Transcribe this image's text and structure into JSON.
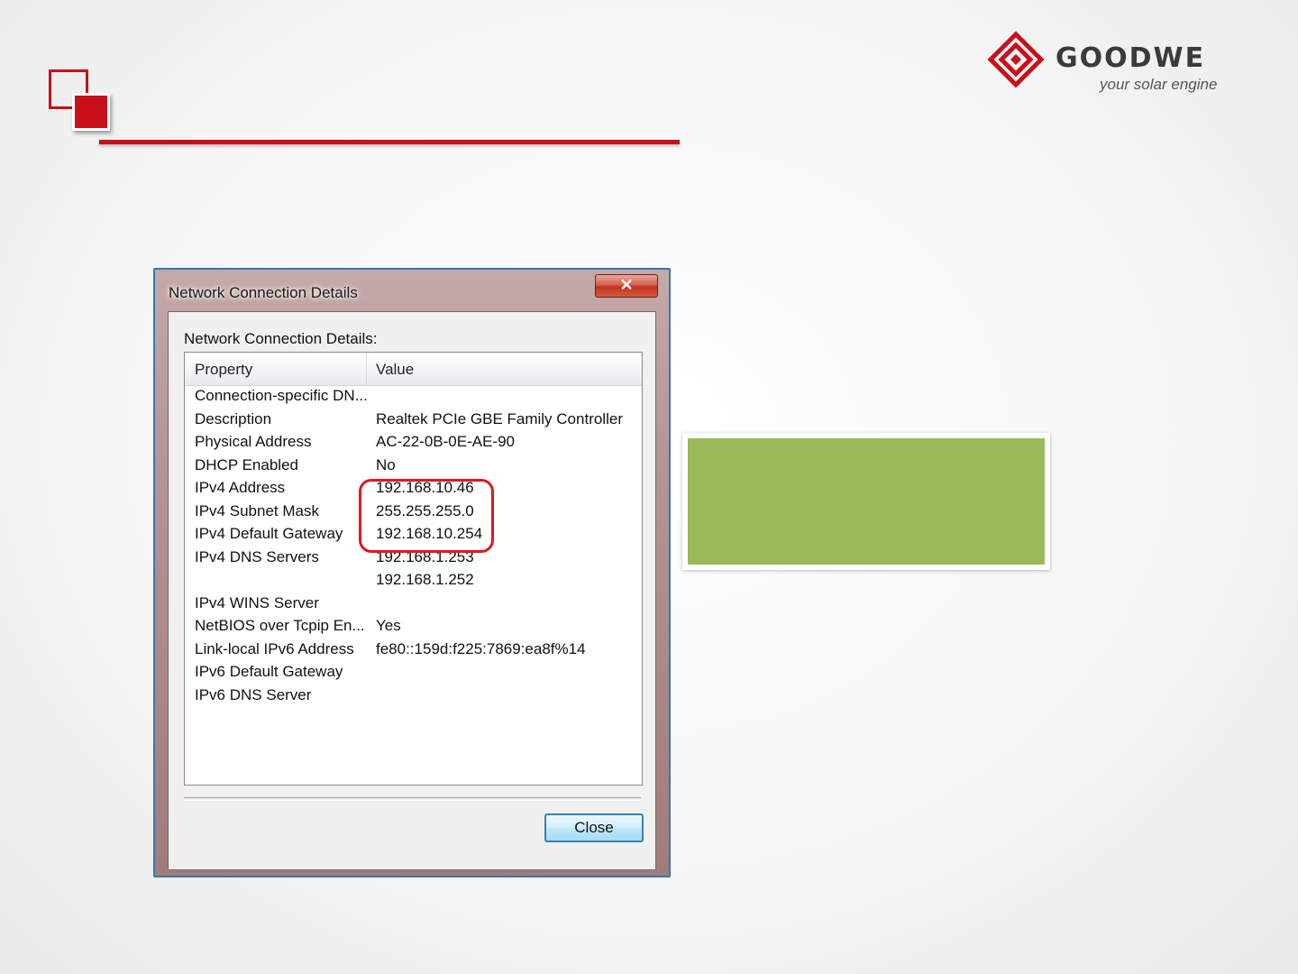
{
  "slide": {
    "accent_color": "#c8101c",
    "logo": {
      "brand": "GOODWE",
      "tagline": "your solar engine",
      "icon": "goodwe-diamond-icon"
    }
  },
  "dialog": {
    "title": "Network Connection Details",
    "close_glyph": "✕",
    "group_label": "Network Connection Details:",
    "columns": [
      "Property",
      "Value"
    ],
    "rows": [
      {
        "property": "Connection-specific DN...",
        "value": ""
      },
      {
        "property": "Description",
        "value": "Realtek PCIe GBE Family Controller"
      },
      {
        "property": "Physical Address",
        "value": "AC-22-0B-0E-AE-90"
      },
      {
        "property": "DHCP Enabled",
        "value": "No"
      },
      {
        "property": "IPv4 Address",
        "value": "192.168.10.46"
      },
      {
        "property": "IPv4 Subnet Mask",
        "value": "255.255.255.0"
      },
      {
        "property": "IPv4 Default Gateway",
        "value": "192.168.10.254"
      },
      {
        "property": "IPv4 DNS Servers",
        "value": "192.168.1.253"
      },
      {
        "property": "",
        "value": "192.168.1.252"
      },
      {
        "property": "IPv4 WINS Server",
        "value": ""
      },
      {
        "property": "NetBIOS over Tcpip En...",
        "value": "Yes"
      },
      {
        "property": "Link-local IPv6 Address",
        "value": "fe80::159d:f225:7869:ea8f%14"
      },
      {
        "property": "IPv6 Default Gateway",
        "value": ""
      },
      {
        "property": "IPv6 DNS Server",
        "value": ""
      }
    ],
    "highlight_color": "#e0181f",
    "close_button": "Close"
  },
  "green_box": {
    "color": "#9bbb59"
  }
}
